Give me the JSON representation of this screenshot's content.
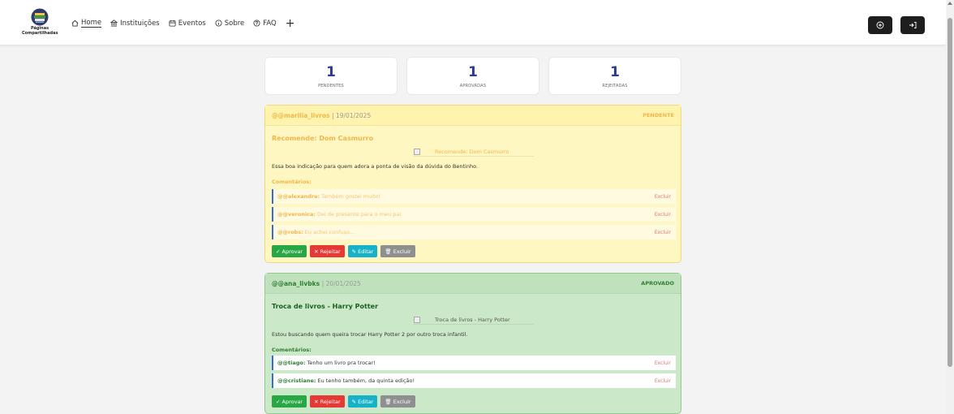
{
  "header": {
    "logo_line1": "Páginas",
    "logo_line2": "Compartilhadas",
    "nav": [
      {
        "label": "Home",
        "icon": "home-icon"
      },
      {
        "label": "Instituições",
        "icon": "institution-icon"
      },
      {
        "label": "Eventos",
        "icon": "calendar-icon"
      },
      {
        "label": "Sobre",
        "icon": "info-icon"
      },
      {
        "label": "FAQ",
        "icon": "help-icon"
      }
    ],
    "plus": "+",
    "right_buttons": [
      "plus-circle-icon",
      "login-icon"
    ]
  },
  "stats": [
    {
      "value": "1",
      "label": "PENDENTES"
    },
    {
      "value": "1",
      "label": "APROVADAS"
    },
    {
      "value": "1",
      "label": "REJEITADAS"
    }
  ],
  "posts": [
    {
      "author": "@@marilia_livros",
      "date": "| 19/01/2025",
      "status": "PENDENTE",
      "title": "Recomende: Dom Casmurro",
      "image_alt": "Recomende: Dom Casmurro",
      "description": "Essa boa indicação para quem adora a ponta de visão da dúvida do Bentinho.",
      "comments_label": "Comentários:",
      "comments": [
        {
          "author": "@@alexandre:",
          "text": "Também gostei muito!",
          "delete": "Excluir"
        },
        {
          "author": "@@veronica:",
          "text": "Dei de presente para o meu pai.",
          "delete": "Excluir"
        },
        {
          "author": "@@robs:",
          "text": "Eu achei confuso...",
          "delete": "Excluir"
        }
      ],
      "actions": {
        "approve": "✓ Aprovar",
        "reject": "✕ Rejeitar",
        "edit": "✎ Editar",
        "delete": "🗑 Excluir"
      }
    },
    {
      "author": "@@ana_livbks",
      "date": "| 20/01/2025",
      "status": "APROVADO",
      "title": "Troca de livros - Harry Potter",
      "image_alt": "Troca de livros - Harry Potter",
      "description": "Estou buscando quem queira trocar Harry Potter 2 por outro troca infantil.",
      "comments_label": "Comentários:",
      "comments": [
        {
          "author": "@@tiago:",
          "text": "Tenho um livro pra trocar!",
          "delete": "Excluir"
        },
        {
          "author": "@@cristiane:",
          "text": "Eu tenho também, da quinta edição!",
          "delete": "Excluir"
        }
      ],
      "actions": {
        "approve": "✓ Aprovar",
        "reject": "✕ Rejeitar",
        "edit": "✎ Editar",
        "delete": "🗑 Excluir"
      }
    }
  ]
}
